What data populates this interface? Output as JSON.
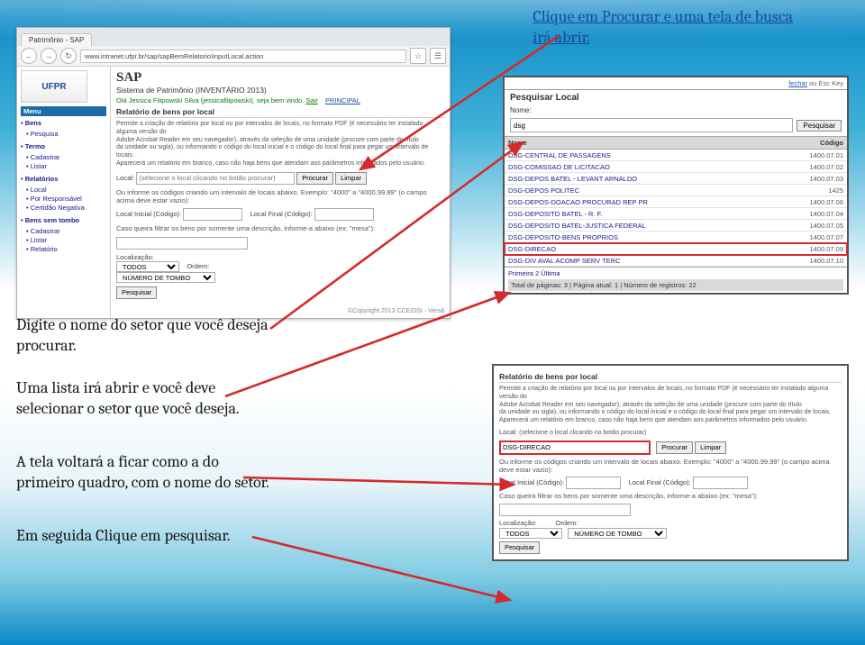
{
  "callouts": {
    "top_right_l1": "Clique em Procurar e uma tela de busca",
    "top_right_l2": "irá abrir.",
    "left1_l1": "Digite o nome do setor que você deseja",
    "left1_l2": "procurar.",
    "left2_l1": "Uma lista irá abrir e você deve",
    "left2_l2": "selecionar o setor que você deseja.",
    "left3_l1": "A tela voltará a ficar como a do",
    "left3_l2": "primeiro quadro, com o nome do setor.",
    "left4": "Em seguida Clique em pesquisar."
  },
  "browser": {
    "tab_title": "Patrimônio - SAP",
    "url": "www.intranet.ufpr.br/sap/sapBemRelatorio!inputLocal.action",
    "logo": "UFPR",
    "sap_title": "SAP",
    "sap_sub": "Sistema de Patrimônio (INVENTÁRIO 2013)",
    "greeting": "Olá Jessica Filipowski Silva (jessicafilipowski), seja bem vindo.",
    "link_sair": "Sair",
    "link_principal": "PRINCIPAL",
    "menu_hdr": "Menu",
    "menu_groups": [
      {
        "label": "Bens",
        "items": [
          "Pesquisa"
        ]
      },
      {
        "label": "Termo",
        "items": [
          "Cadastrar",
          "Listar"
        ]
      },
      {
        "label": "Relatórios",
        "items": [
          "Local",
          "Por Responsável",
          "Certidão Negativa"
        ]
      },
      {
        "label": "Bens sem tombo",
        "items": [
          "Cadastrar",
          "Listar",
          "Relatório"
        ]
      }
    ],
    "section_title": "Relatório de bens por local",
    "desc1": "Permite a criação de relatório por local ou por intervalos de locais, no formato PDF (é necessário ter instalado alguma versão do",
    "desc2": "Adobe Acrobat Reader em seu navegador), através da seleção de uma unidade (procure com parte do título",
    "desc3": "da unidade ou sigla), ou informando o código do local inicial e o código do local final para pegar um intervalo de locais.",
    "desc4": "Aparecerá um relatório em branco, caso não haja bens que atendam aos parâmetros informados pelo usuário.",
    "label_local": "Local:",
    "placeholder_local": "(selecione o local clicando no botão procurar)",
    "btn_procurar": "Procurar",
    "btn_limpar": "Limpar",
    "label_ou": "Ou informe os códigos criando um intervalo de locais abaixo. Exemplo: \"4000\" a \"4000.99.99\" (o campo acima deve estar vazio):",
    "label_li": "Local Inicial (Código):",
    "label_lf": "Local Final (Código):",
    "label_filtro": "Caso queira filtrar os bens por somente uma descrição, informe-a abaixo (ex: \"mesa\"):",
    "label_loc": "Localização:",
    "sel_loc": "TODOS",
    "label_ord": "Ordem:",
    "sel_ord": "NÚMERO DE TOMBO",
    "btn_pesquisar": "Pesquisar",
    "copyright": "©Copyright 2013 CCE/DSI - Versã"
  },
  "popup": {
    "close": "fechar",
    "or_esc": " ou Esc Key",
    "title": "Pesquisar Local",
    "label_nome": "Nome:",
    "value_nome": "dsg",
    "btn_pesq": "Pesquisar",
    "th_nome": "Nome",
    "th_codigo": "Código",
    "rows": [
      {
        "n": "DSG-CENTRAL DE PASSAGENS",
        "c": "1400.07.01"
      },
      {
        "n": "DSG-COMISSAO DE LICITACAO",
        "c": "1400.07.02"
      },
      {
        "n": "DSG-DEPOS BATEL - LEVANT ARNALDO",
        "c": "1400.07.03"
      },
      {
        "n": "DSG-DEPOS POLITEC",
        "c": "1425"
      },
      {
        "n": "DSG-DEPOS-DOACAO PROCURAD REP PR",
        "c": "1400.07.06"
      },
      {
        "n": "DSG-DEPOSITO BATEL - R. F.",
        "c": "1400.07.04"
      },
      {
        "n": "DSG-DEPOSITO BATEL-JUSTICA FEDERAL",
        "c": "1400.07.05"
      },
      {
        "n": "DSG-DEPOSITO-BENS PROPRIOS",
        "c": "1400.07.07"
      },
      {
        "n": "DSG-DIRECAO",
        "c": "1400.07.09"
      },
      {
        "n": "DSG-DIV AVAL ACOMP SERV TERC",
        "c": "1400.07.10"
      }
    ],
    "pager": "Primeira   2   Última",
    "info": "Total de páginas: 3  |  Página atual: 1  |  Número de registros: 22"
  },
  "panelb": {
    "section_title": "Relatório de bens por local",
    "desc1": "Permite a criação de relatório por local ou por intervalos de locais, no formato PDF (é necessário ter instalado alguma versão do",
    "desc2": "Adobe Acrobat Reader em seu navegador), através da seleção de uma unidade (procure com parte do título",
    "desc3": "da unidade ou sigla), ou informando o código do local inicial e o código do local final para pegar um intervalo de locais.",
    "desc4": "Aparecerá um relatório em branco, caso não haja bens que atendam aos parâmetros informados pelo usuário.",
    "label_local": "Local:",
    "placeholder_local": "(selecione o local clicando no botão procurar)",
    "value_local": "DSG-DIRECAO",
    "btn_procurar": "Procurar",
    "btn_limpar": "Limpar",
    "label_ou": "Ou informe os códigos criando um intervalo de locais abaixo. Exemplo: \"4000\" a \"4000.99.99\" (o campo acima deve estar vazio):",
    "label_li": "Local Inicial (Código):",
    "label_lf": "Local Final (Código):",
    "label_filtro": "Caso queira filtrar os bens por somente uma descrição, informe-a abaixo (ex: \"mesa\"):",
    "label_loc": "Localização:",
    "sel_loc": "TODOS",
    "label_ord": "Ordem:",
    "sel_ord": "NÚMERO DE TOMBO",
    "btn_pesquisar": "Pesquisar"
  }
}
